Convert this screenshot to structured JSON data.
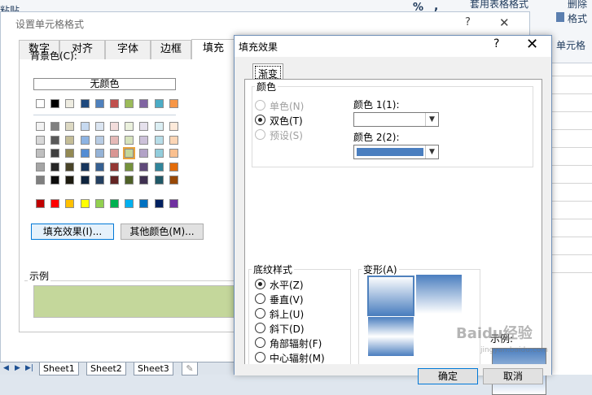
{
  "ribbon": {
    "paste_label": "粘贴",
    "clipboard_label": "剪贴",
    "percent": "%",
    "comma": ",",
    "table_format": "套用表格格式",
    "delete": "删除",
    "format": "格式",
    "cell_styles": "单元格"
  },
  "sheet_tabs": [
    "Sheet1",
    "Sheet2",
    "Sheet3"
  ],
  "format_cells": {
    "title": "设置单元格格式",
    "help": "?",
    "close": "✕",
    "tabs": [
      "数字",
      "对齐",
      "字体",
      "边框",
      "填充"
    ],
    "background_color_label": "背景色(C):",
    "no_color": "无颜色",
    "palette_top": [
      "#ffffff",
      "#000000",
      "#eeece1",
      "#1f497d",
      "#4f81bd",
      "#c0504d",
      "#9bbb59",
      "#8064a2",
      "#4bacc6",
      "#f79646"
    ],
    "palette_grid": [
      [
        "#f2f2f2",
        "#7f7f7f",
        "#ddd9c3",
        "#c6d9f0",
        "#dbe5f1",
        "#f2dcdb",
        "#ebf1dd",
        "#e5e0ec",
        "#dbeef3",
        "#fdeada"
      ],
      [
        "#d8d8d8",
        "#595959",
        "#c4bd97",
        "#8db3e2",
        "#b8cce4",
        "#e5b9b7",
        "#d7e3bc",
        "#ccc1d9",
        "#b7dde8",
        "#fbd5b5"
      ],
      [
        "#bfbfbf",
        "#3f3f3f",
        "#938953",
        "#548dd4",
        "#95b3d7",
        "#d99694",
        "#c3d69b",
        "#b2a2c7",
        "#92cddc",
        "#fac08f"
      ],
      [
        "#a5a5a5",
        "#262626",
        "#494429",
        "#17365d",
        "#366092",
        "#953734",
        "#76923c",
        "#5f497a",
        "#31859b",
        "#e36c09"
      ],
      [
        "#7f7f7f",
        "#0c0c0c",
        "#1d1b10",
        "#0f243e",
        "#244061",
        "#632423",
        "#4f6128",
        "#3f3151",
        "#205867",
        "#974806"
      ]
    ],
    "palette_standard": [
      "#c00000",
      "#ff0000",
      "#ffc000",
      "#ffff00",
      "#92d050",
      "#00b050",
      "#00b0f0",
      "#0070c0",
      "#002060",
      "#7030a0"
    ],
    "fill_effects_button": "填充效果(I)...",
    "more_colors_button": "其他颜色(M)...",
    "sample_label": "示例",
    "sample_color": "#c4d79b"
  },
  "fill_effects": {
    "title": "填充效果",
    "help": "?",
    "close": "✕",
    "tab": "渐变",
    "colors_group": "颜色",
    "color_options": [
      "单色(N)",
      "双色(T)",
      "预设(S)"
    ],
    "color1_label": "颜色 1(1):",
    "color2_label": "颜色 2(2):",
    "color2_value": "#4a7ebf",
    "shading_group": "底纹样式",
    "shading_options": [
      "水平(Z)",
      "垂直(V)",
      "斜上(U)",
      "斜下(D)",
      "角部辐射(F)",
      "中心辐射(M)"
    ],
    "variants_label": "变形(A)",
    "sample_label": "示例:",
    "ok_button": "确定",
    "cancel_button": "取消"
  },
  "watermark": {
    "brand": "Baidu经验",
    "url": "jingyan.baidu.com"
  }
}
